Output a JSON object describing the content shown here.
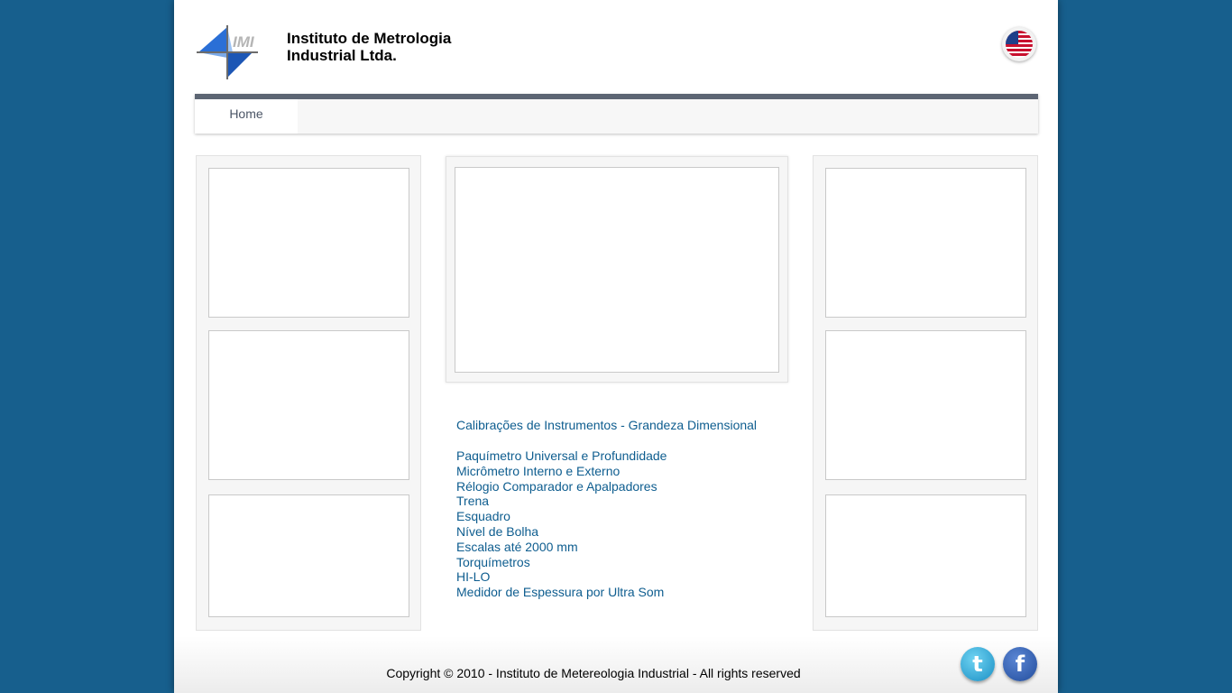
{
  "header": {
    "logo_mark_text": "IMI",
    "logo_line1": "Instituto de Metrologia",
    "logo_line2": "Industrial Ltda.",
    "language_icon": "us-flag-icon"
  },
  "nav": {
    "items": [
      {
        "label": "Home"
      }
    ]
  },
  "services": {
    "heading": "Calibrações de Instrumentos - Grandeza Dimensional",
    "items": [
      "Paquímetro Universal e Profundidade",
      "Micrômetro Interno e Externo",
      "Rélogio Comparador e Apalpadores",
      "Trena",
      "Esquadro",
      "Nível de Bolha",
      "Escalas até 2000 mm",
      "Torquímetros",
      "HI-LO",
      "Medidor de Espessura por Ultra Som"
    ]
  },
  "footer": {
    "copyright": "Copyright © 2010 - Instituto de Metereologia Industrial - All rights reserved",
    "social": [
      {
        "name": "twitter",
        "icon": "twitter-icon",
        "glyph": "t"
      },
      {
        "name": "facebook",
        "icon": "facebook-icon",
        "glyph": "f"
      }
    ]
  },
  "colors": {
    "background": "#175f8d",
    "nav_bar_top": "#5c6573",
    "link_text": "#0e5d8f"
  }
}
